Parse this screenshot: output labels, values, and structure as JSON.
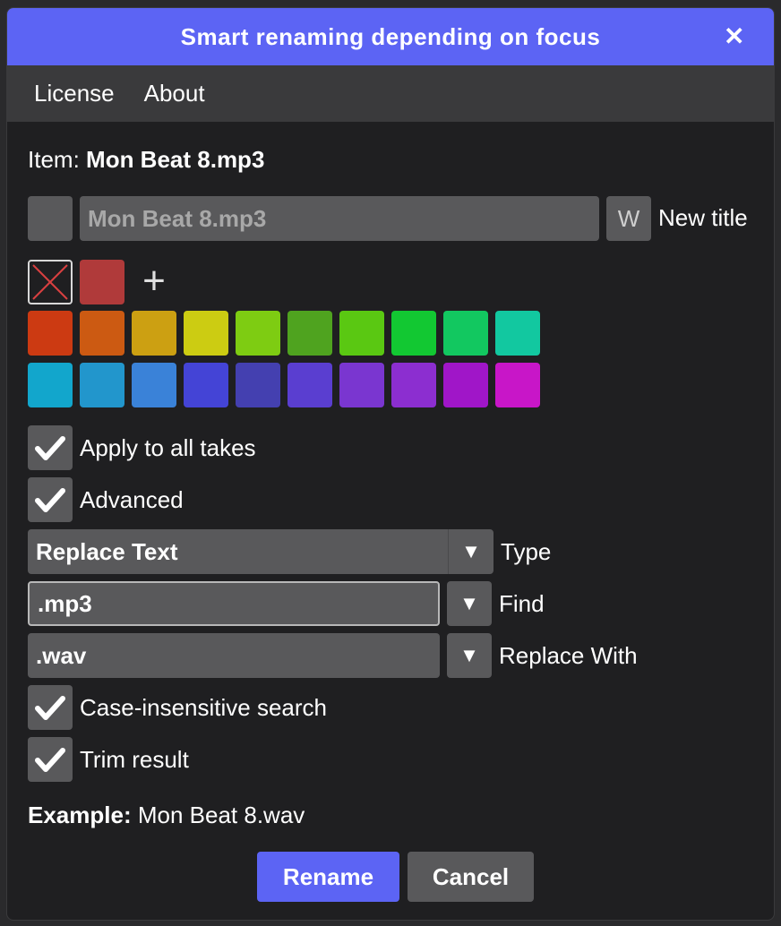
{
  "window": {
    "title": "Smart renaming depending on focus",
    "close_glyph": "✕"
  },
  "menu": {
    "license": "License",
    "about": "About"
  },
  "item": {
    "label": "Item:",
    "name": "Mon Beat 8.mp3"
  },
  "title_row": {
    "value": "Mon Beat 8.mp3",
    "w_button": "W",
    "new_title_label": "New title"
  },
  "colors": {
    "current": "#b03a3a",
    "add_glyph": "+",
    "row1": [
      "#cc3a12",
      "#cc5a12",
      "#cca012",
      "#cccc12",
      "#7ecc12",
      "#4fa31f",
      "#5ac812",
      "#12c832",
      "#12c860",
      "#12c8a0"
    ],
    "row2": [
      "#12a6cc",
      "#2296cc",
      "#3a82d8",
      "#4444d6",
      "#4440b0",
      "#5a3ed0",
      "#7a36d0",
      "#8c2ed0",
      "#a016c8",
      "#c816c8"
    ]
  },
  "options": {
    "apply_all_takes": "Apply to all takes",
    "advanced": "Advanced",
    "case_insensitive": "Case-insensitive search",
    "trim_result": "Trim result"
  },
  "advanced": {
    "type_value": "Replace Text",
    "type_label": "Type",
    "find_value": ".mp3",
    "find_label": "Find",
    "replace_value": ".wav",
    "replace_label": "Replace With",
    "dropdown_glyph": "▼"
  },
  "example": {
    "label": "Example:",
    "value": "Mon Beat 8.wav"
  },
  "buttons": {
    "rename": "Rename",
    "cancel": "Cancel"
  }
}
